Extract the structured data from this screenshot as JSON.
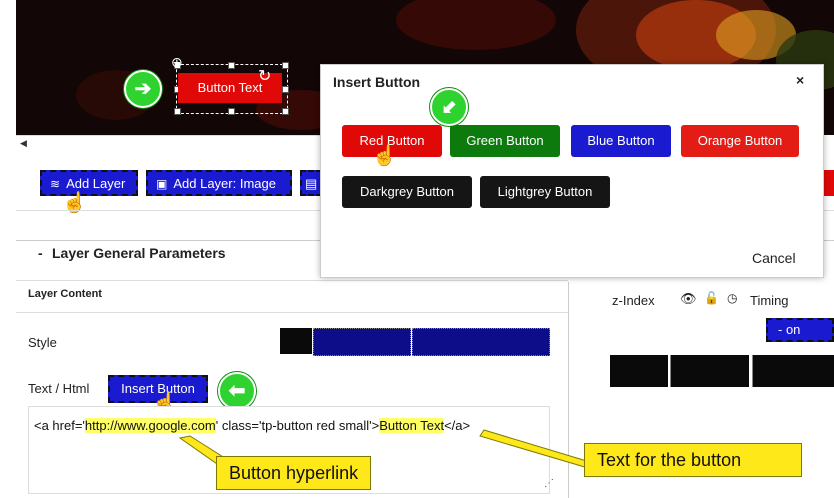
{
  "colors": {
    "red": "#e10808",
    "green": "#0c7a0c",
    "blue": "#1a1ad0",
    "orange": "#e31d15",
    "darkgrey": "#151515",
    "lightgrey": "#151515",
    "accent_green": "#2fd32f",
    "callout": "#ffe81a"
  },
  "slide": {
    "button_text": "Button Text"
  },
  "toolbar": {
    "add_layer": "Add Layer",
    "add_layer_image": "Add Layer: Image"
  },
  "dialog": {
    "title": "Insert Button",
    "close": "×",
    "buttons": [
      "Red Button",
      "Green Button",
      "Blue Button",
      "Orange Button",
      "Darkgrey Button",
      "Lightgrey Button"
    ],
    "cancel": "Cancel"
  },
  "params": {
    "section_title": "Layer General Parameters",
    "collapse": "-",
    "layer_content": "Layer Content",
    "style_label": "Style",
    "text_html_label": "Text / Html",
    "insert_button": "Insert Button",
    "code": {
      "part1": "<a href='",
      "href": "http://www.google.com",
      "part2": "' class='tp-button red small'>",
      "text": "Button Text",
      "part3": "</a>"
    }
  },
  "right_panel": {
    "z_index": "z-Index",
    "timing": "Timing",
    "on_button": "- on"
  },
  "callouts": {
    "hyperlink": "Button hyperlink",
    "text": "Text for the button"
  },
  "icons": {
    "eye": "eye-icon",
    "lock": "lock-icon",
    "clock": "clock-icon",
    "layers": "layers-icon",
    "image": "image-icon"
  }
}
